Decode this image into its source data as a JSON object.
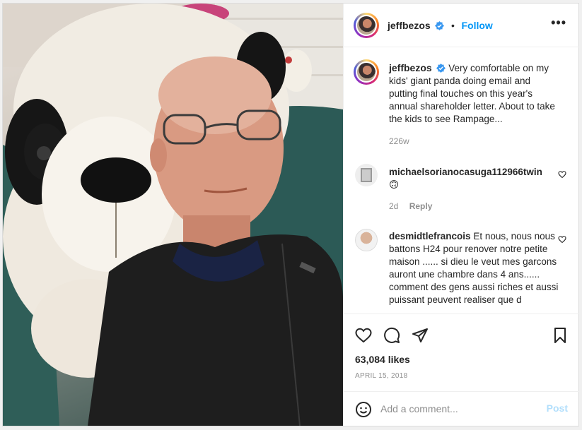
{
  "header": {
    "username": "jeffbezos",
    "follow_label": "Follow",
    "separator": "•",
    "more_label": "•••"
  },
  "caption": {
    "username": "jeffbezos",
    "text": "Very comfortable on my kids' giant panda doing email and putting final touches on this year's annual shareholder letter. About to take the kids to see Rampage...",
    "age": "226w"
  },
  "comments": [
    {
      "username": "michaelsorianocasuga112966twin",
      "text": "🙃",
      "age": "2d",
      "reply_label": "Reply"
    },
    {
      "username": "desmidtlefrancois",
      "text": "Et nous, nous nous battons H24 pour renover notre petite maison ...... si dieu le veut mes garcons auront une chambre dans 4 ans...... comment des gens aussi riches et aussi puissant peuvent realiser que d"
    }
  ],
  "engagement": {
    "likes": "63,084 likes",
    "date": "APRIL 15, 2018"
  },
  "composer": {
    "placeholder": "Add a comment...",
    "post_label": "Post"
  },
  "icons": {
    "like": "heart-icon",
    "comment": "comment-icon",
    "share": "paper-plane-icon",
    "save": "bookmark-icon",
    "emoji": "smiley-icon",
    "verified": "verified-badge-icon"
  },
  "colors": {
    "link_blue": "#0095f6",
    "post_disabled": "#b2dffc",
    "secondary_text": "#8e8e8e",
    "verified_blue": "#3897f0"
  }
}
